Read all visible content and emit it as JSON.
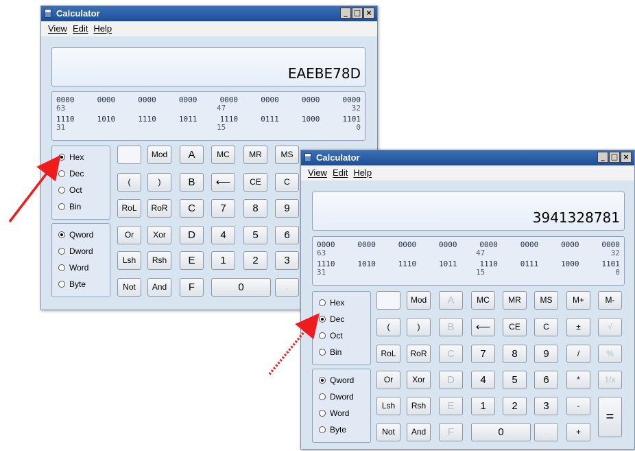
{
  "window1": {
    "title": "Calculator",
    "title_controls": [
      "_",
      "□",
      "×"
    ],
    "menu": [
      "View",
      "Edit",
      "Help"
    ],
    "display_value": "EAEBE78D",
    "bits": {
      "row1": [
        "0000",
        "0000",
        "0000",
        "0000",
        "0000",
        "0000",
        "0000",
        "0000"
      ],
      "row1_labels": [
        "63",
        "47",
        "32"
      ],
      "row2": [
        "1110",
        "1010",
        "1110",
        "1011",
        "1110",
        "0111",
        "1000",
        "1101"
      ],
      "row2_labels": [
        "31",
        "15",
        "0"
      ]
    },
    "base_options": [
      "Hex",
      "Dec",
      "Oct",
      "Bin"
    ],
    "base_selected": "Hex",
    "word_options": [
      "Qword",
      "Dword",
      "Word",
      "Byte"
    ],
    "word_selected": "Qword",
    "buttons": {
      "mod": "Mod",
      "a": "A",
      "mc": "MC",
      "mr": "MR",
      "ms": "MS",
      "lparen": "(",
      "rparen": ")",
      "b": "B",
      "back": "⟵",
      "ce": "CE",
      "c": "C",
      "rol": "RoL",
      "ror": "RoR",
      "hc": "C",
      "n7": "7",
      "n8": "8",
      "n9": "9",
      "or": "Or",
      "xor": "Xor",
      "d": "D",
      "n4": "4",
      "n5": "5",
      "n6": "6",
      "lsh": "Lsh",
      "rsh": "Rsh",
      "e": "E",
      "n1": "1",
      "n2": "2",
      "n3": "3",
      "not": "Not",
      "and": "And",
      "f": "F",
      "n0": "0",
      "dot": "."
    }
  },
  "window2": {
    "title": "Calculator",
    "title_controls": [
      "_",
      "□",
      "×"
    ],
    "menu": [
      "View",
      "Edit",
      "Help"
    ],
    "display_value": "3941328781",
    "bits": {
      "row1": [
        "0000",
        "0000",
        "0000",
        "0000",
        "0000",
        "0000",
        "0000",
        "0000"
      ],
      "row1_labels": [
        "63",
        "47",
        "32"
      ],
      "row2": [
        "1110",
        "1010",
        "1110",
        "1011",
        "1110",
        "0111",
        "1000",
        "1101"
      ],
      "row2_labels": [
        "31",
        "15",
        "0"
      ]
    },
    "base_options": [
      "Hex",
      "Dec",
      "Oct",
      "Bin"
    ],
    "base_selected": "Dec",
    "word_options": [
      "Qword",
      "Dword",
      "Word",
      "Byte"
    ],
    "word_selected": "Qword",
    "buttons": {
      "mod": "Mod",
      "a": "A",
      "mc": "MC",
      "mr": "MR",
      "ms": "MS",
      "mplus": "M+",
      "mminus": "M-",
      "lparen": "(",
      "rparen": ")",
      "b": "B",
      "back": "⟵",
      "ce": "CE",
      "c": "C",
      "pm": "±",
      "sqrt": "√",
      "rol": "RoL",
      "ror": "RoR",
      "hc": "C",
      "n7": "7",
      "n8": "8",
      "n9": "9",
      "div": "/",
      "pct": "%",
      "or": "Or",
      "xor": "Xor",
      "d": "D",
      "n4": "4",
      "n5": "5",
      "n6": "6",
      "mul": "*",
      "recip": "1/x",
      "lsh": "Lsh",
      "rsh": "Rsh",
      "e": "E",
      "n1": "1",
      "n2": "2",
      "n3": "3",
      "sub": "-",
      "eq": "=",
      "not": "Not",
      "and": "And",
      "f": "F",
      "n0": "0",
      "dot": ".",
      "add": "+"
    }
  },
  "colors": {
    "arrow": "#ee1c1c",
    "titlebar": "#2a5ea8",
    "window_bg": "#d9e4f1"
  }
}
